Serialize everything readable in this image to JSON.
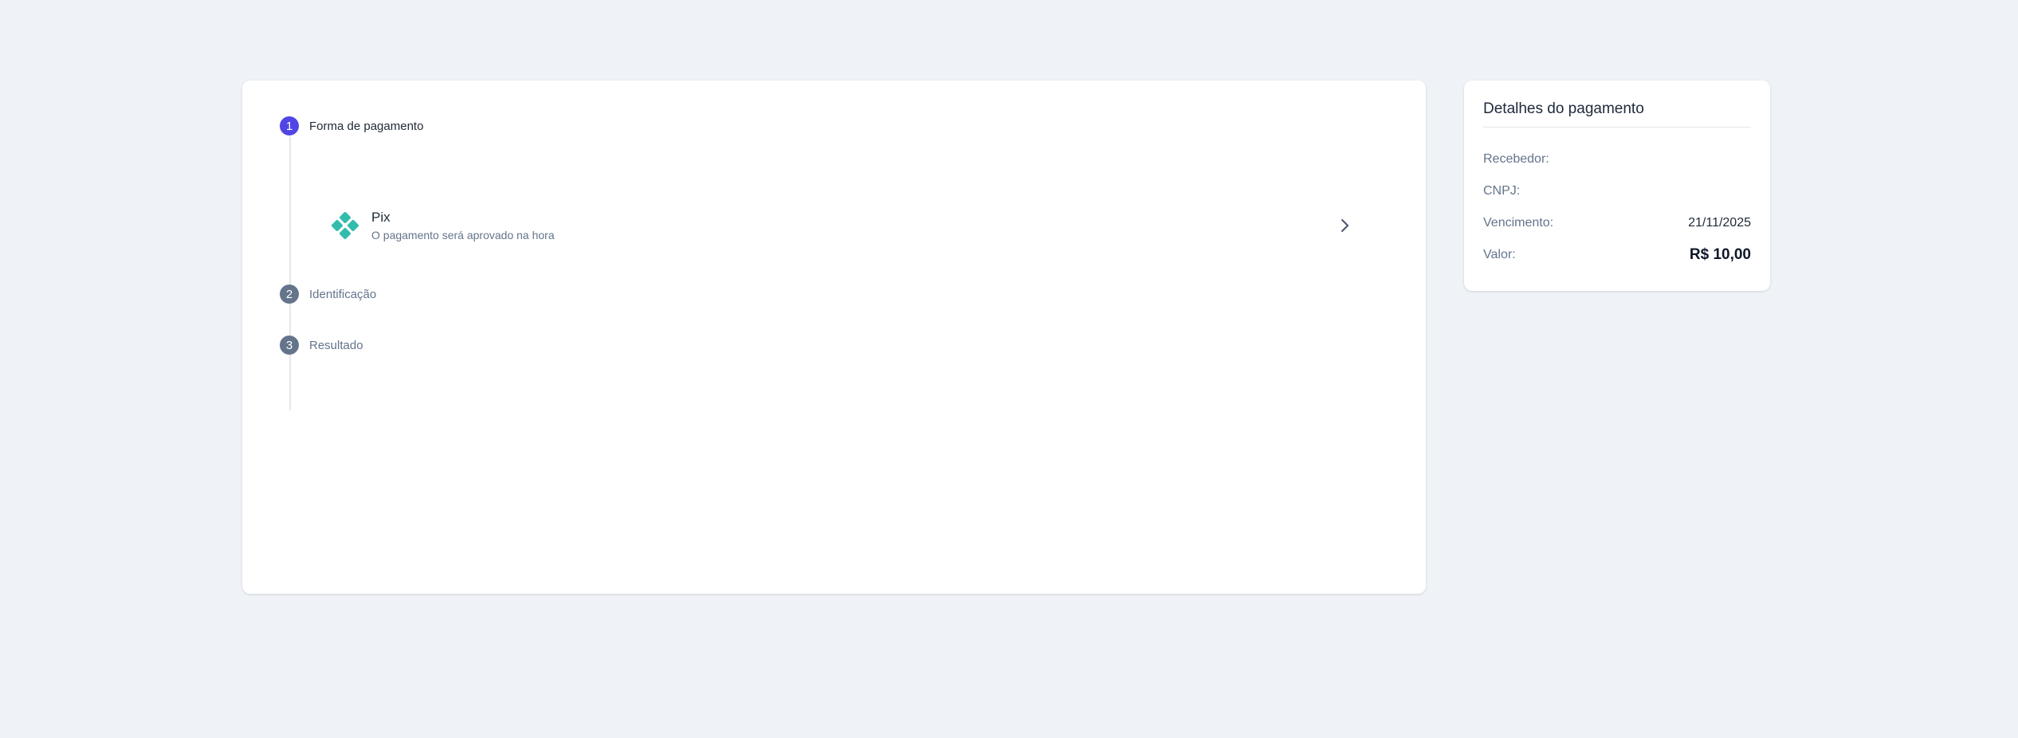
{
  "colors": {
    "background": "#eff2f7",
    "accent": "#4f46e5",
    "inactive_step": "#64748b",
    "pix": "#32bcad"
  },
  "steps": [
    {
      "number": "1",
      "label": "Forma de pagamento",
      "state": "active"
    },
    {
      "number": "2",
      "label": "Identificação",
      "state": "inactive"
    },
    {
      "number": "3",
      "label": "Resultado",
      "state": "inactive"
    }
  ],
  "payment_option": {
    "icon": "pix-icon",
    "title": "Pix",
    "subtitle": "O pagamento será aprovado na hora",
    "action_icon": "chevron-right-icon"
  },
  "details": {
    "title": "Detalhes do pagamento",
    "rows": [
      {
        "label": "Recebedor:",
        "value": ""
      },
      {
        "label": "CNPJ:",
        "value": ""
      },
      {
        "label": "Vencimento:",
        "value": "21/11/2025"
      },
      {
        "label": "Valor:",
        "value": "R$ 10,00"
      }
    ]
  }
}
